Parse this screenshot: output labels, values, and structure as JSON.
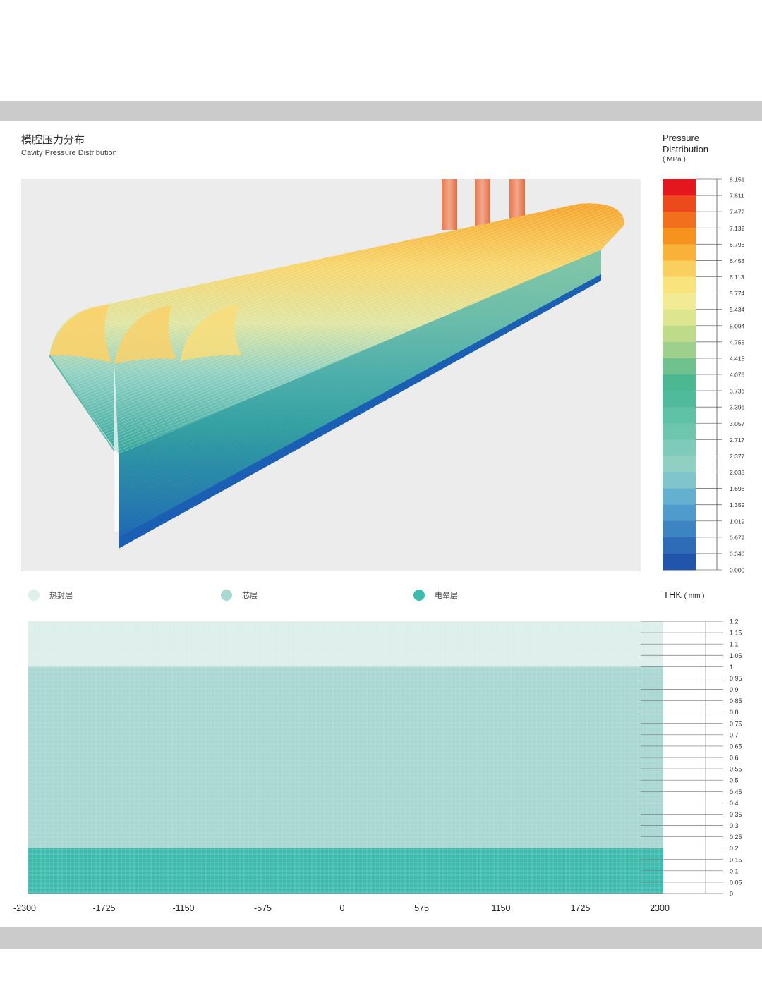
{
  "header": {
    "title_cn": "模腔压力分布",
    "title_en": "Cavity Pressure Distribution"
  },
  "pressure_legend": {
    "title_line1": "Pressure",
    "title_line2": "Distribution",
    "unit": "( MPa )",
    "ticks": [
      "8.151",
      "7.811",
      "7.472",
      "7.132",
      "6.793",
      "6.453",
      "6.113",
      "5.774",
      "5.434",
      "5.094",
      "4.755",
      "4.415",
      "4.076",
      "3.736",
      "3.396",
      "3.057",
      "2.717",
      "2.377",
      "2.038",
      "1.698",
      "1.359",
      "1.019",
      "0.679",
      "0.340",
      "0.000"
    ],
    "colors": [
      "#e3171d",
      "#ec4a1c",
      "#f26f1e",
      "#f6921e",
      "#f9b13a",
      "#fbcf5f",
      "#f9e37c",
      "#f2ea95",
      "#dce68e",
      "#bedb8a",
      "#9cd08c",
      "#6fc28e",
      "#4cb891",
      "#4fbb9c",
      "#5fc1a6",
      "#6ec6af",
      "#7dcbb8",
      "#8fd0c2",
      "#80c4cc",
      "#63b0cf",
      "#4f9bcb",
      "#3d84c2",
      "#2e6cb8",
      "#2154ab"
    ]
  },
  "layers": {
    "items": [
      {
        "label": "热封层",
        "color": "#dcefeb"
      },
      {
        "label": "芯层",
        "color": "#a9d7d1"
      },
      {
        "label": "电晕层",
        "color": "#3ebbad"
      }
    ]
  },
  "thickness_chart": {
    "title": "THK",
    "unit": "( mm )"
  },
  "chart_data": {
    "type": "area",
    "title": "THK ( mm )",
    "x": [
      -2300,
      -1725,
      -1150,
      -575,
      0,
      575,
      1150,
      1725,
      2300
    ],
    "xlim": [
      -2300,
      2300
    ],
    "ylim": [
      0,
      1.2
    ],
    "y_ticks": [
      "1.2",
      "1.15",
      "1.1",
      "1.05",
      "1",
      "0.95",
      "0.9",
      "0.85",
      "0.8",
      "0.75",
      "0.7",
      "0.65",
      "0.6",
      "0.55",
      "0.5",
      "0.45",
      "0.4",
      "0.35",
      "0.3",
      "0.25",
      "0.2",
      "0.15",
      "0.1",
      "0.05",
      "0"
    ],
    "series": [
      {
        "name": "电晕层",
        "bottom": 0,
        "top": 0.2,
        "color": "#3ebbad"
      },
      {
        "name": "芯层",
        "bottom": 0.2,
        "top": 1.0,
        "color": "#a9d7d1"
      },
      {
        "name": "热封层",
        "bottom": 1.0,
        "top": 1.2,
        "color": "#dcefeb"
      }
    ]
  }
}
